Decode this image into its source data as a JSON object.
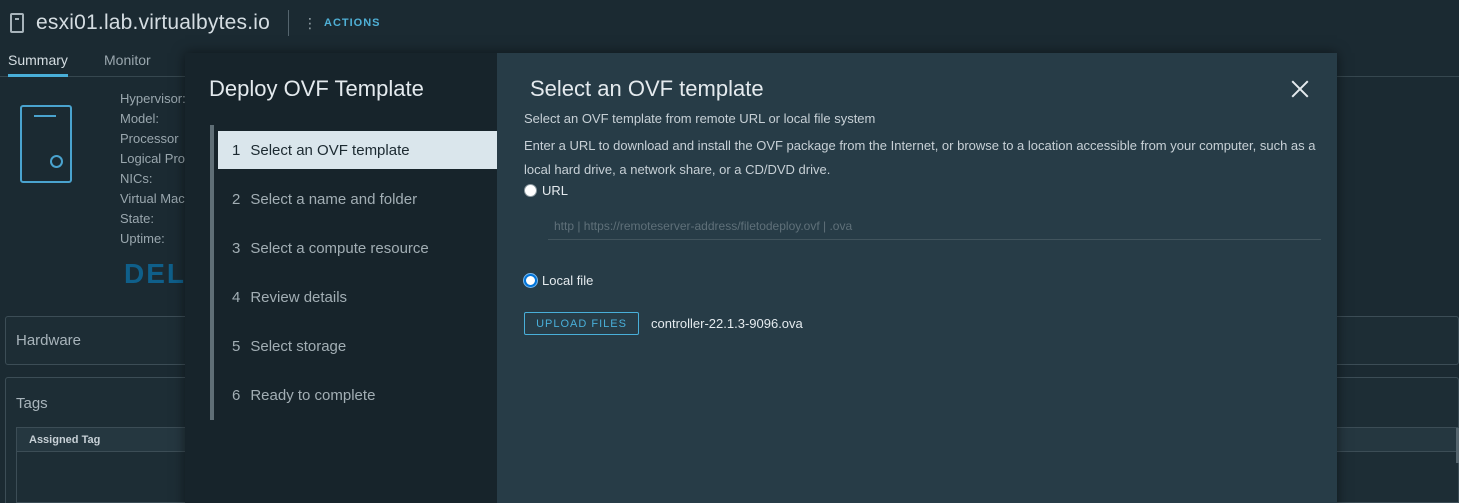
{
  "host": {
    "title": "esxi01.lab.virtualbytes.io",
    "actions_label": "ACTIONS"
  },
  "background_tabs": [
    {
      "label": "Summary",
      "active": true
    },
    {
      "label": "Monitor",
      "active": false
    }
  ],
  "host_properties": [
    "Hypervisor:",
    "Model:",
    "Processor",
    "Logical Pro",
    "NICs:",
    "Virtual Mac",
    "State:",
    "Uptime:"
  ],
  "vendor_logo": "DELL",
  "hardware_card": {
    "title": "Hardware"
  },
  "tags_card": {
    "title": "Tags",
    "column_header": "Assigned Tag"
  },
  "wizard": {
    "title": "Deploy OVF Template",
    "steps": [
      {
        "num": "1",
        "label": "Select an OVF template",
        "active": true
      },
      {
        "num": "2",
        "label": "Select a name and folder",
        "active": false
      },
      {
        "num": "3",
        "label": "Select a compute resource",
        "active": false
      },
      {
        "num": "4",
        "label": "Review details",
        "active": false
      },
      {
        "num": "5",
        "label": "Select storage",
        "active": false
      },
      {
        "num": "6",
        "label": "Ready to complete",
        "active": false
      }
    ]
  },
  "content": {
    "title": "Select an OVF template",
    "subtitle": "Select an OVF template from remote URL or local file system",
    "description": "Enter a URL to download and install the OVF package from the Internet, or browse to a location accessible from your computer, such as a local hard drive, a network share, or a CD/DVD drive.",
    "url_option": {
      "label": "URL",
      "selected": false
    },
    "url_input": {
      "value": "",
      "placeholder": "http | https://remoteserver-address/filetodeploy.ovf | .ova"
    },
    "local_option": {
      "label": "Local file",
      "selected": true
    },
    "upload_button": "UPLOAD FILES",
    "selected_file": "controller-22.1.3-9096.ova"
  },
  "colors": {
    "accent": "#49afd9",
    "modal_nav_bg": "#17242b",
    "modal_content_bg": "#273c47",
    "page_bg": "#1b2a32",
    "active_step_bg": "#dae6ec"
  }
}
